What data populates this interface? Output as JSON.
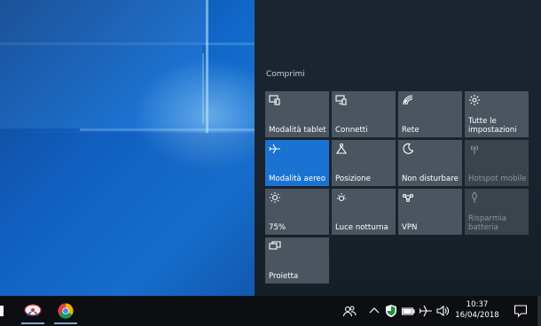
{
  "action_center": {
    "collapse_label": "Comprimi",
    "accent_color": "#1a73d2",
    "tiles": [
      {
        "label": "Modalità tablet",
        "icon": "tablet-mode-icon",
        "state": "normal"
      },
      {
        "label": "Connetti",
        "icon": "connect-icon",
        "state": "normal"
      },
      {
        "label": "Rete",
        "icon": "network-icon",
        "state": "normal"
      },
      {
        "label": "Tutte le impostazioni",
        "icon": "settings-icon",
        "state": "normal"
      },
      {
        "label": "Modalità aereo",
        "icon": "airplane-icon",
        "state": "active"
      },
      {
        "label": "Posizione",
        "icon": "location-icon",
        "state": "normal"
      },
      {
        "label": "Non disturbare",
        "icon": "moon-icon",
        "state": "normal"
      },
      {
        "label": "Hotspot mobile",
        "icon": "hotspot-icon",
        "state": "disabled"
      },
      {
        "label": "75%",
        "icon": "brightness-icon",
        "state": "normal"
      },
      {
        "label": "Luce notturna",
        "icon": "night-light-icon",
        "state": "normal"
      },
      {
        "label": "VPN",
        "icon": "vpn-icon",
        "state": "normal"
      },
      {
        "label": "Risparmia batteria",
        "icon": "battery-saver-icon",
        "state": "disabled"
      },
      {
        "label": "Proietta",
        "icon": "project-icon",
        "state": "normal"
      }
    ]
  },
  "taskbar": {
    "apps": [
      {
        "name": "app-icon-generic"
      },
      {
        "name": "chrome-icon"
      }
    ],
    "tray_icons": [
      "people-icon",
      "chevron-up-icon",
      "defender-shield-icon",
      "battery-icon",
      "airplane-tray-icon",
      "volume-icon"
    ],
    "time": "10:37",
    "date": "16/04/2018",
    "notification_icon": "action-center-icon"
  }
}
